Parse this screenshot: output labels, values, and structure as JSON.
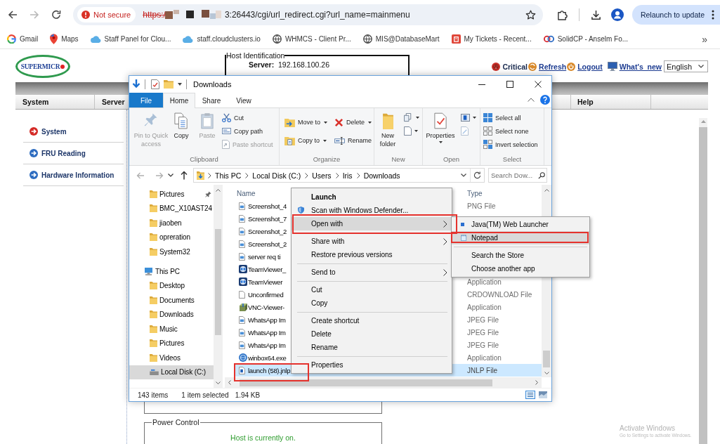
{
  "browser": {
    "nav_buttons": [
      {
        "kind": "back",
        "disabled": false
      },
      {
        "kind": "forward",
        "disabled": true
      },
      {
        "kind": "reload",
        "disabled": false
      }
    ],
    "security_label": "Not secure",
    "url_scheme": "https:/",
    "url_text": "3:26443/cgi/url_redirect.cgi?url_name=mainmenu",
    "relaunch_button": "Relaunch to update",
    "bookmarks": [
      {
        "label": "Gmail"
      },
      {
        "label": "Maps"
      },
      {
        "label": "Staff Panel for Clou..."
      },
      {
        "label": "staff.cloudclusters.io"
      },
      {
        "label": "WHMCS - Client Pr..."
      },
      {
        "label": "MIS@DatabaseMart"
      },
      {
        "label": "My Tickets - Recent..."
      },
      {
        "label": "SolidCP - Anselm Fo..."
      }
    ],
    "bookmarks_overflow": "»"
  },
  "page": {
    "logo": "SUPERMICR",
    "host_identification": {
      "legend": "Host Identification",
      "rows": [
        {
          "label": "Server:",
          "value": "192.168.100.26"
        }
      ]
    },
    "header_links": [
      {
        "label": "Critical",
        "kind": "alert"
      },
      {
        "label": "Refresh",
        "kind": "refresh"
      },
      {
        "label": "Logout",
        "kind": "logout"
      },
      {
        "label": "What's_new",
        "kind": "news"
      }
    ],
    "language": "English",
    "menu": [
      {
        "label": "System"
      },
      {
        "label": "Server"
      },
      {
        "label": "Help"
      }
    ],
    "sidebar": [
      {
        "label": "System",
        "selected": true
      },
      {
        "label": "FRU Reading",
        "selected": false
      },
      {
        "label": "Hardware Information",
        "selected": false
      }
    ],
    "power_control": {
      "legend": "Power Control",
      "status": "Host is currently on."
    }
  },
  "explorer": {
    "title": "Downloads",
    "tabs": [
      {
        "label": "File",
        "kind": "file",
        "selected": false
      },
      {
        "label": "Home",
        "kind": "tab",
        "selected": true
      },
      {
        "label": "Share",
        "kind": "tab",
        "selected": false
      },
      {
        "label": "View",
        "kind": "tab",
        "selected": false
      }
    ],
    "ribbon": {
      "groups": [
        {
          "label": "Clipboard",
          "items": [
            {
              "label": "Pin to Quick access",
              "disabled": true
            },
            {
              "label": "Copy",
              "disabled": false
            },
            {
              "label": "Paste",
              "disabled": true
            },
            {
              "label": "Cut",
              "disabled": false
            },
            {
              "label": "Copy path",
              "disabled": false
            },
            {
              "label": "Paste shortcut",
              "disabled": true
            }
          ]
        },
        {
          "label": "Organize",
          "items": [
            {
              "label": "Move to",
              "disabled": false
            },
            {
              "label": "Copy to",
              "disabled": false
            },
            {
              "label": "Delete",
              "disabled": false
            },
            {
              "label": "Rename",
              "disabled": false
            }
          ]
        },
        {
          "label": "New",
          "items": [
            {
              "label": "New folder",
              "disabled": false
            }
          ]
        },
        {
          "label": "Open",
          "items": [
            {
              "label": "Properties",
              "disabled": false
            }
          ]
        },
        {
          "label": "Select",
          "items": [
            {
              "label": "Select all",
              "disabled": false
            },
            {
              "label": "Select none",
              "disabled": false
            },
            {
              "label": "Invert selection",
              "disabled": false
            }
          ]
        }
      ]
    },
    "nav_buttons": [
      {
        "kind": "back",
        "disabled": true
      },
      {
        "kind": "forward",
        "disabled": true
      },
      {
        "kind": "recent",
        "disabled": false
      },
      {
        "kind": "up",
        "disabled": false
      }
    ],
    "breadcrumb": [
      {
        "label": "This PC"
      },
      {
        "label": "Local Disk (C:)"
      },
      {
        "label": "Users"
      },
      {
        "label": "Iris"
      },
      {
        "label": "Downloads"
      }
    ],
    "search": {
      "placeholder": "Search Dow..."
    },
    "nav_tree": [
      {
        "children": [
          {
            "label": "Pictures",
            "kind": "folder",
            "pinned": true,
            "selected": false
          },
          {
            "label": "BMC_X10AST24",
            "kind": "folder",
            "pinned": false,
            "selected": false
          },
          {
            "label": "jiaoben",
            "kind": "folder",
            "pinned": false,
            "selected": false
          },
          {
            "label": "opreration",
            "kind": "folder",
            "pinned": false,
            "selected": false
          },
          {
            "label": "System32",
            "kind": "folder",
            "pinned": false,
            "selected": false
          }
        ]
      },
      {
        "label": "This PC",
        "kind": "computer",
        "selected": false,
        "children": [
          {
            "label": "Desktop",
            "kind": "folder",
            "selected": false
          },
          {
            "label": "Documents",
            "kind": "folder",
            "selected": false
          },
          {
            "label": "Downloads",
            "kind": "folder",
            "selected": false
          },
          {
            "label": "Music",
            "kind": "folder",
            "selected": false
          },
          {
            "label": "Pictures",
            "kind": "folder",
            "selected": false
          },
          {
            "label": "Videos",
            "kind": "folder",
            "selected": false
          },
          {
            "label": "Local Disk (C:)",
            "kind": "drive",
            "selected": true
          }
        ]
      }
    ],
    "columns": [
      {
        "label": "Name"
      },
      {
        "label": "Type"
      }
    ],
    "files": [
      {
        "name": "Screenshot_4",
        "kind": "image",
        "type": "PNG File",
        "selected": false,
        "annotated": false
      },
      {
        "name": "Screenshot_7",
        "kind": "image",
        "selected": false,
        "annotated": false
      },
      {
        "name": "Screenshot_2",
        "kind": "image",
        "selected": false,
        "annotated": false
      },
      {
        "name": "Screenshot_2",
        "kind": "image",
        "selected": false,
        "annotated": false
      },
      {
        "name": "server req ti",
        "kind": "image",
        "selected": false,
        "annotated": false
      },
      {
        "name": "TeamViewer_",
        "kind": "app",
        "selected": false,
        "annotated": false
      },
      {
        "name": "TeamViewer",
        "kind": "app",
        "type": "Application",
        "selected": false,
        "annotated": false
      },
      {
        "name": "Unconfirmed",
        "kind": "blank",
        "type": "CRDOWNLOAD File",
        "selected": false,
        "annotated": false
      },
      {
        "name": "VNC-Viewer-",
        "kind": "installer",
        "type": "Application",
        "selected": false,
        "annotated": false
      },
      {
        "name": "WhatsApp Im",
        "kind": "image",
        "type": "JPEG File",
        "selected": false,
        "annotated": false
      },
      {
        "name": "WhatsApp Im",
        "kind": "image",
        "type": "JPEG File",
        "selected": false,
        "annotated": false
      },
      {
        "name": "WhatsApp Im",
        "kind": "image",
        "type": "JPEG File",
        "selected": false,
        "annotated": false
      },
      {
        "name": "winbox64.exe",
        "kind": "executable",
        "type": "Application",
        "selected": false,
        "annotated": false
      },
      {
        "name": "launch (58).jnlp",
        "kind": "jnlp",
        "type": "JNLP File",
        "selected": true,
        "annotated": true
      }
    ],
    "status": {
      "item_count": "143 items",
      "selection": "1 item selected",
      "size": "1.94 KB"
    }
  },
  "context_menu": {
    "groups": [
      [
        {
          "label": "Launch",
          "default": true,
          "submenu": false,
          "highlighted": false,
          "annotated": false
        },
        {
          "label": "Scan with Windows Defender...",
          "default": false,
          "submenu": false,
          "highlighted": false,
          "annotated": false
        },
        {
          "label": "Open with",
          "default": false,
          "submenu": true,
          "highlighted": true,
          "annotated": true
        }
      ],
      [
        {
          "label": "Share with",
          "default": false,
          "submenu": true,
          "highlighted": false,
          "annotated": false
        },
        {
          "label": "Restore previous versions",
          "default": false,
          "submenu": false,
          "highlighted": false,
          "annotated": false
        }
      ],
      [
        {
          "label": "Send to",
          "default": false,
          "submenu": true,
          "highlighted": false,
          "annotated": false
        }
      ],
      [
        {
          "label": "Cut",
          "default": false,
          "submenu": false,
          "highlighted": false,
          "annotated": false
        },
        {
          "label": "Copy",
          "default": false,
          "submenu": false,
          "highlighted": false,
          "annotated": false
        }
      ],
      [
        {
          "label": "Create shortcut",
          "default": false,
          "submenu": false,
          "highlighted": false,
          "annotated": false
        },
        {
          "label": "Delete",
          "default": false,
          "submenu": false,
          "highlighted": false,
          "annotated": false
        },
        {
          "label": "Rename",
          "default": false,
          "submenu": false,
          "highlighted": false,
          "annotated": false
        }
      ],
      [
        {
          "label": "Properties",
          "default": false,
          "submenu": false,
          "highlighted": false,
          "annotated": false
        }
      ]
    ]
  },
  "open_with_menu": {
    "groups": [
      [
        {
          "label": "Java(TM) Web Launcher",
          "highlighted": false,
          "annotated": false
        },
        {
          "label": "Notepad",
          "highlighted": true,
          "annotated": true
        }
      ],
      [
        {
          "label": "Search the Store",
          "highlighted": false,
          "annotated": false
        },
        {
          "label": "Choose another app",
          "highlighted": false,
          "annotated": false
        }
      ]
    ]
  },
  "os_notice": {
    "title": "Activate Windows",
    "text": "Go to Settings to activate Windows."
  }
}
